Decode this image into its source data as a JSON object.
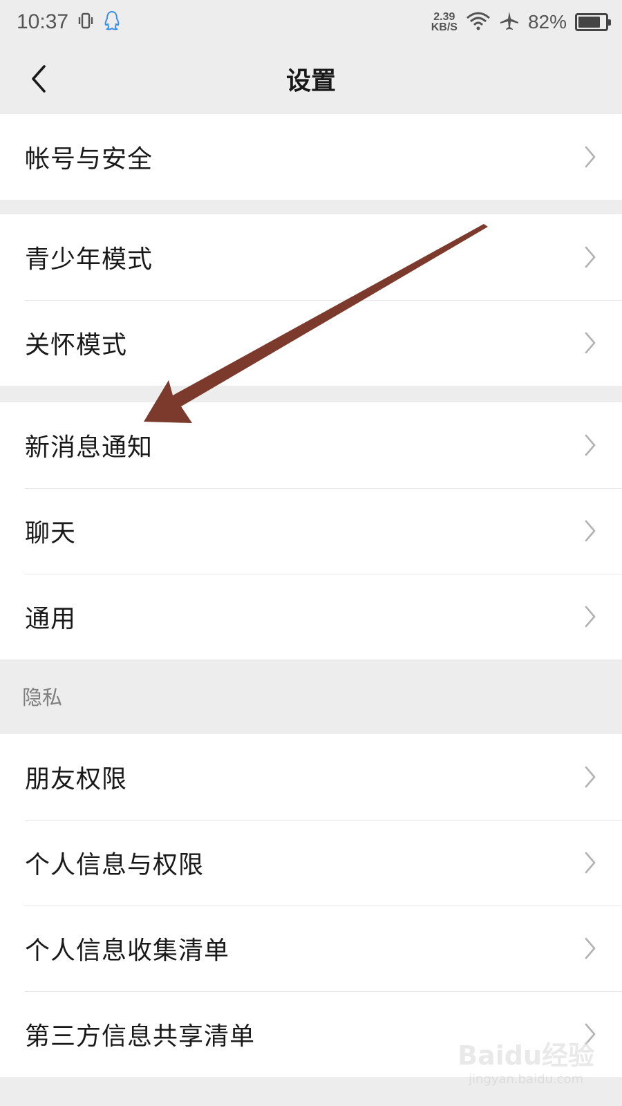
{
  "status_bar": {
    "time": "10:37",
    "net_speed_value": "2.39",
    "net_speed_unit": "KB/S",
    "battery_percent": "82%",
    "battery_level": 0.82,
    "icons": [
      "vibrate-icon",
      "qq-penguin-icon",
      "wifi-icon",
      "airplane-icon",
      "battery-icon"
    ]
  },
  "nav": {
    "title": "设置",
    "back_icon": "chevron-left-icon"
  },
  "groups": [
    {
      "items": [
        {
          "label": "帐号与安全"
        }
      ]
    },
    {
      "items": [
        {
          "label": "青少年模式"
        },
        {
          "label": "关怀模式"
        }
      ]
    },
    {
      "items": [
        {
          "label": "新消息通知"
        },
        {
          "label": "聊天"
        },
        {
          "label": "通用"
        }
      ]
    },
    {
      "section_title": "隐私",
      "items": [
        {
          "label": "朋友权限"
        },
        {
          "label": "个人信息与权限"
        },
        {
          "label": "个人信息收集清单"
        },
        {
          "label": "第三方信息共享清单"
        }
      ]
    }
  ],
  "annotation": {
    "color": "#7b3a2c"
  },
  "watermark": {
    "main": "Baidu经验",
    "sub": "jingyan.baidu.com"
  }
}
